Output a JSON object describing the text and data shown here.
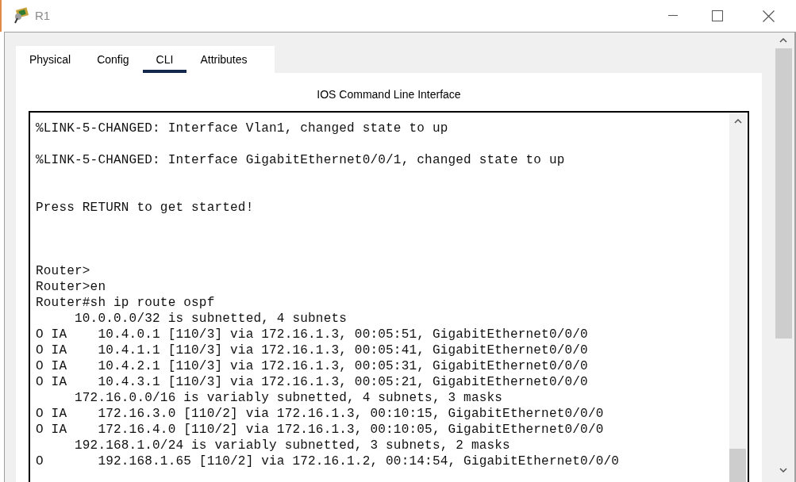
{
  "window": {
    "title": "R1"
  },
  "tabs": [
    {
      "label": "Physical",
      "selected": false
    },
    {
      "label": "Config",
      "selected": false
    },
    {
      "label": "CLI",
      "selected": true
    },
    {
      "label": "Attributes",
      "selected": false
    }
  ],
  "panel_title": "IOS Command Line Interface",
  "terminal": {
    "lines": [
      {
        "kind": "text",
        "text": "%LINK-5-CHANGED: Interface Vlan1, changed state to up"
      },
      {
        "kind": "blank"
      },
      {
        "kind": "text",
        "text": "%LINK-5-CHANGED: Interface GigabitEthernet0/0/1, changed state to up"
      },
      {
        "kind": "blank"
      },
      {
        "kind": "blank"
      },
      {
        "kind": "text",
        "text": "Press RETURN to get started!"
      },
      {
        "kind": "blank"
      },
      {
        "kind": "blank"
      },
      {
        "kind": "blank"
      },
      {
        "kind": "text",
        "text": "Router>"
      },
      {
        "kind": "text",
        "text": "Router>en"
      },
      {
        "kind": "text",
        "text": "Router#sh ip route ospf"
      },
      {
        "kind": "text",
        "text": "     10.0.0.0/32 is subnetted, 4 subnets"
      },
      {
        "kind": "text",
        "text": "O IA    10.4.0.1 [110/3] via 172.16.1.3, 00:05:51, GigabitEthernet0/0/0"
      },
      {
        "kind": "text",
        "text": "O IA    10.4.1.1 [110/3] via 172.16.1.3, 00:05:41, GigabitEthernet0/0/0"
      },
      {
        "kind": "text",
        "text": "O IA    10.4.2.1 [110/3] via 172.16.1.3, 00:05:31, GigabitEthernet0/0/0"
      },
      {
        "kind": "text",
        "text": "O IA    10.4.3.1 [110/3] via 172.16.1.3, 00:05:21, GigabitEthernet0/0/0"
      },
      {
        "kind": "text",
        "text": "     172.16.0.0/16 is variably subnetted, 4 subnets, 3 masks"
      },
      {
        "kind": "text",
        "text": "O IA    172.16.3.0 [110/2] via 172.16.1.3, 00:10:15, GigabitEthernet0/0/0"
      },
      {
        "kind": "text",
        "text": "O IA    172.16.4.0 [110/2] via 172.16.1.3, 00:10:05, GigabitEthernet0/0/0"
      },
      {
        "kind": "text",
        "text": "     192.168.1.0/24 is variably subnetted, 3 subnets, 2 masks"
      },
      {
        "kind": "text",
        "text": "O       192.168.1.65 [110/2] via 172.16.1.2, 00:14:54, GigabitEthernet0/0/0"
      }
    ]
  }
}
